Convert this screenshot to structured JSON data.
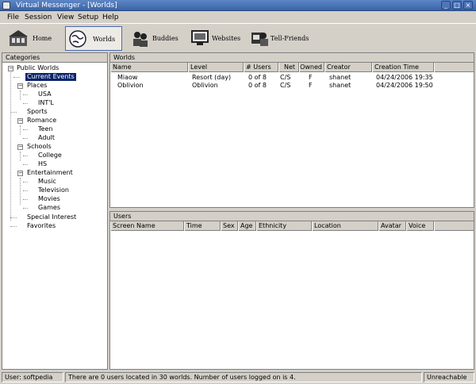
{
  "window": {
    "title": "Virtual Messenger - [Worlds]",
    "min": "_",
    "max": "□",
    "close": "×"
  },
  "menu": [
    "File",
    "Session",
    "View",
    "Setup",
    "Help"
  ],
  "toolbar": [
    {
      "label": "Home"
    },
    {
      "label": "Worlds"
    },
    {
      "label": "Buddies"
    },
    {
      "label": "Websites"
    },
    {
      "label": "Tell-Friends"
    }
  ],
  "categories": {
    "header": "Categories",
    "tree": {
      "public": "Public Worlds",
      "current": "Current Events",
      "places": "Places",
      "usa": "USA",
      "intl": "INT'L",
      "sports": "Sports",
      "romance": "Romance",
      "teen": "Teen",
      "adult": "Adult",
      "schools": "Schools",
      "college": "College",
      "hs": "HS",
      "entertainment": "Entertainment",
      "music": "Music",
      "television": "Television",
      "movies": "Movies",
      "games": "Games",
      "special": "Special Interest",
      "favorites": "Favorites"
    }
  },
  "worlds": {
    "header": "Worlds",
    "columns": [
      "Name",
      "Level",
      "# Users",
      "Net",
      "Owned",
      "Creator",
      "Creation Time"
    ],
    "rows": [
      [
        "Miaow",
        "Resort (day)",
        "0 of 8",
        "C/S",
        "F",
        "shanet",
        "04/24/2006 19:35"
      ],
      [
        "Oblivion",
        "Oblivion",
        "0 of 8",
        "C/S",
        "F",
        "shanet",
        "04/24/2006 19:50"
      ]
    ]
  },
  "users": {
    "header": "Users",
    "columns": [
      "Screen Name",
      "Time",
      "Sex",
      "Age",
      "Ethnicity",
      "Location",
      "Avatar",
      "Voice"
    ]
  },
  "status": {
    "user": "User: softpedia",
    "message": "There are 0 users located in 30 worlds. Number of users logged on is 4.",
    "state": "Unreachable"
  }
}
